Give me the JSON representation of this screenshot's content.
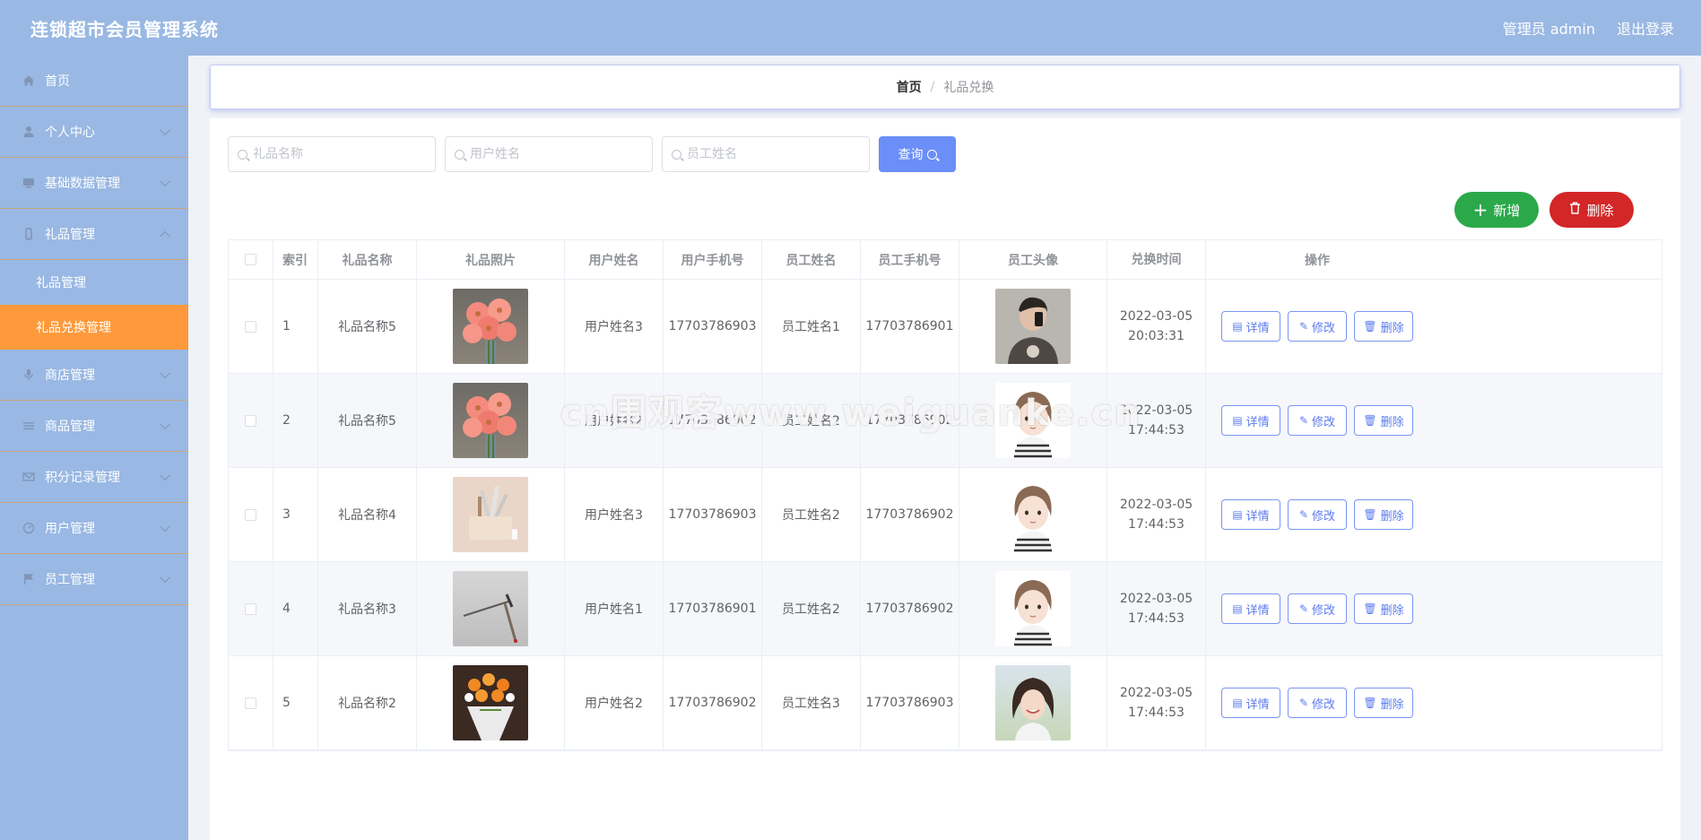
{
  "header": {
    "title": "连锁超市会员管理系统",
    "user_label": "管理员 admin",
    "logout_label": "退出登录"
  },
  "sidebar": {
    "items": [
      {
        "label": "首页",
        "icon": "home-icon"
      },
      {
        "label": "个人中心",
        "icon": "user-icon"
      },
      {
        "label": "基础数据管理",
        "icon": "monitor-icon"
      },
      {
        "label": "礼品管理",
        "icon": "phone-icon"
      },
      {
        "label": "商店管理",
        "icon": "mic-icon"
      },
      {
        "label": "商品管理",
        "icon": "menu-icon"
      },
      {
        "label": "积分记录管理",
        "icon": "mail-icon"
      },
      {
        "label": "用户管理",
        "icon": "gauge-icon"
      },
      {
        "label": "员工管理",
        "icon": "flag-icon"
      }
    ],
    "submenu": [
      {
        "label": "礼品管理"
      },
      {
        "label": "礼品兑换管理"
      }
    ]
  },
  "breadcrumb": {
    "home": "首页",
    "sep": "/",
    "current": "礼品兑换"
  },
  "search": {
    "gift_name_placeholder": "礼品名称",
    "user_name_placeholder": "用户姓名",
    "staff_name_placeholder": "员工姓名",
    "query_label": "查询"
  },
  "actions": {
    "add_label": "新增",
    "delete_label": "删除"
  },
  "table": {
    "headers": [
      "索引",
      "礼品名称",
      "礼品照片",
      "用户姓名",
      "用户手机号",
      "员工姓名",
      "员工手机号",
      "员工头像",
      "兑换时间",
      "操作"
    ],
    "op_labels": {
      "detail": "详情",
      "edit": "修改",
      "delete": "删除"
    },
    "rows": [
      {
        "index": "1",
        "gift_name": "礼品名称5",
        "user_name": "用户姓名3",
        "user_phone": "17703786903",
        "staff_name": "员工姓名1",
        "staff_phone": "17703786901",
        "time": "2022-03-05 20:03:31"
      },
      {
        "index": "2",
        "gift_name": "礼品名称5",
        "user_name": "用户姓名2",
        "user_phone": "17703786902",
        "staff_name": "员工姓名2",
        "staff_phone": "17703786902",
        "time": "2022-03-05 17:44:53"
      },
      {
        "index": "3",
        "gift_name": "礼品名称4",
        "user_name": "用户姓名3",
        "user_phone": "17703786903",
        "staff_name": "员工姓名2",
        "staff_phone": "17703786902",
        "time": "2022-03-05 17:44:53"
      },
      {
        "index": "4",
        "gift_name": "礼品名称3",
        "user_name": "用户姓名1",
        "user_phone": "17703786901",
        "staff_name": "员工姓名2",
        "staff_phone": "17703786902",
        "time": "2022-03-05 17:44:53"
      },
      {
        "index": "5",
        "gift_name": "礼品名称2",
        "user_name": "用户姓名2",
        "user_phone": "17703786902",
        "staff_name": "员工姓名3",
        "staff_phone": "17703786903",
        "time": "2022-03-05 17:44:53"
      }
    ]
  },
  "watermark": "cn围观客www.weiguanke.cn"
}
